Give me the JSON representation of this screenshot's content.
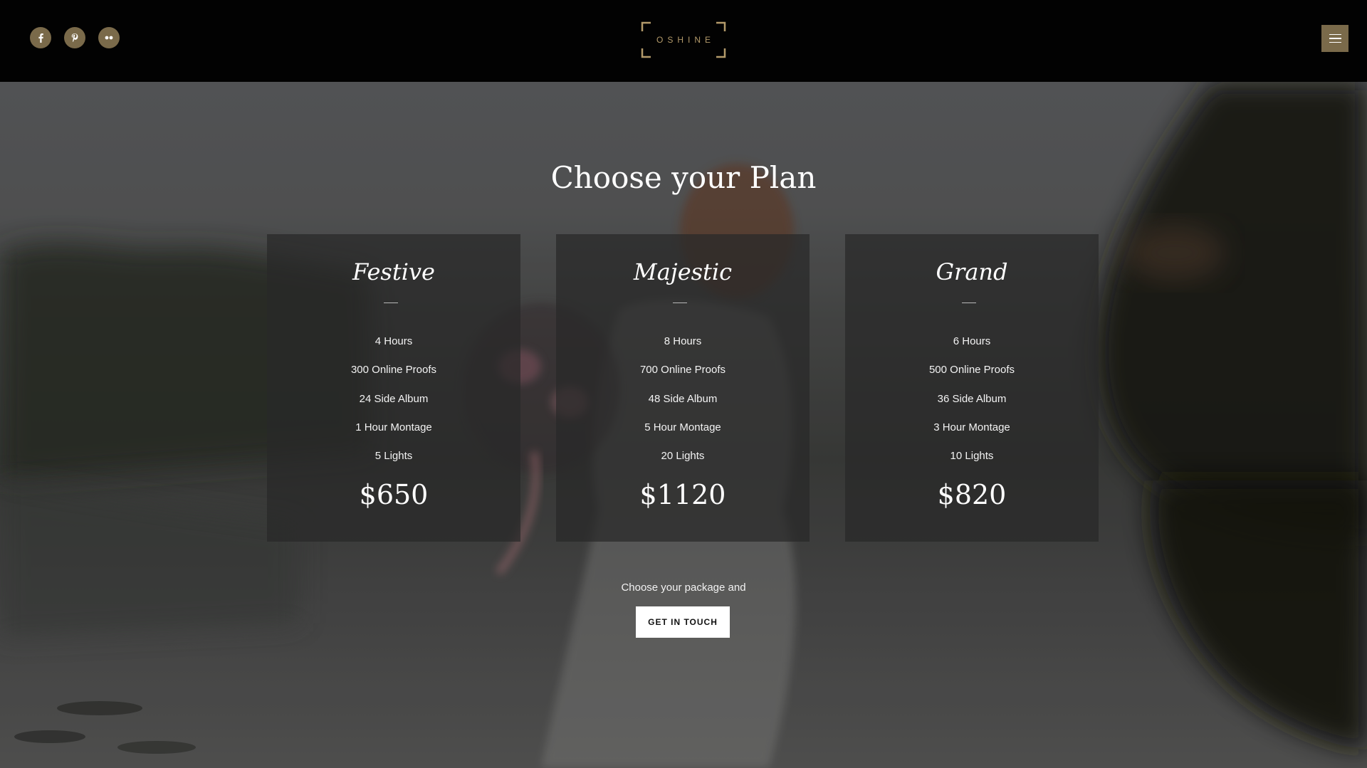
{
  "header": {
    "logo_text": "OSHINE",
    "social": [
      {
        "icon": "facebook-icon"
      },
      {
        "icon": "pinterest-icon"
      },
      {
        "icon": "flickr-icon"
      }
    ],
    "menu_icon": "hamburger-menu-icon",
    "accent_color": "#7a6a4a"
  },
  "hero": {
    "title": "Choose your Plan"
  },
  "plans": [
    {
      "name": "Festive",
      "features": [
        "4 Hours",
        "300 Online Proofs",
        "24 Side Album",
        "1 Hour Montage",
        "5 Lights"
      ],
      "price": "$650"
    },
    {
      "name": "Majestic",
      "features": [
        "8 Hours",
        "700 Online Proofs",
        "48 Side Album",
        "5 Hour Montage",
        "20 Lights"
      ],
      "price": "$1120"
    },
    {
      "name": "Grand",
      "features": [
        "6 Hours",
        "500 Online Proofs",
        "36 Side Album",
        "3 Hour Montage",
        "10 Lights"
      ],
      "price": "$820"
    }
  ],
  "cta": {
    "text": "Choose your package and",
    "button_label": "GET IN TOUCH"
  }
}
